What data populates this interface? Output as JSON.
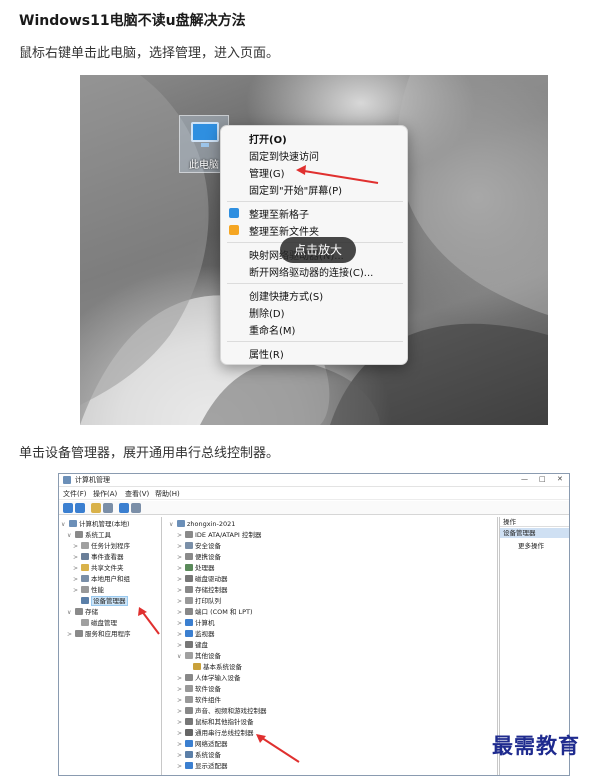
{
  "article": {
    "title": "Windows11电脑不读u盘解决方法",
    "step1": "鼠标右键单击此电脑，选择管理，进入页面。",
    "step2": "单击设备管理器，展开通用串行总线控制器。"
  },
  "screenshot1": {
    "desktop_icon_label": "此电脑",
    "context_menu": [
      {
        "label": "打开(O)",
        "bold": true
      },
      {
        "label": "固定到快速访问"
      },
      {
        "label": "管理(G)"
      },
      {
        "label": "固定到\"开始\"屏幕(P)"
      },
      {
        "label": "整理至新格子",
        "icon": "plus-square-icon"
      },
      {
        "label": "整理至新文件夹",
        "icon": "folder-icon"
      },
      {
        "label": "映射网络驱动器(N)..."
      },
      {
        "label": "断开网络驱动器的连接(C)..."
      },
      {
        "label": "创建快捷方式(S)"
      },
      {
        "label": "删除(D)"
      },
      {
        "label": "重命名(M)"
      },
      {
        "label": "属性(R)"
      }
    ],
    "tooltip": "点击放大",
    "colors": {
      "arrow": "#e0302f",
      "accent_blue": "#2f8fe0",
      "accent_orange": "#f5a623"
    }
  },
  "screenshot2": {
    "window_title": "计算机管理",
    "window_buttons": [
      "—",
      "□",
      "✕"
    ],
    "menu": [
      "文件(F)",
      "操作(A)",
      "查看(V)",
      "帮助(H)"
    ],
    "left_tree": [
      {
        "label": "计算机管理(本地)",
        "level": 0,
        "exp": "∨"
      },
      {
        "label": "系统工具",
        "level": 1,
        "exp": "∨"
      },
      {
        "label": "任务计划程序",
        "level": 2,
        "exp": ">"
      },
      {
        "label": "事件查看器",
        "level": 2,
        "exp": ">"
      },
      {
        "label": "共享文件夹",
        "level": 2,
        "exp": ">"
      },
      {
        "label": "本地用户和组",
        "level": 2,
        "exp": ">"
      },
      {
        "label": "性能",
        "level": 2,
        "exp": ">"
      },
      {
        "label": "设备管理器",
        "level": 2,
        "exp": "",
        "selected": true
      },
      {
        "label": "存储",
        "level": 1,
        "exp": "∨"
      },
      {
        "label": "磁盘管理",
        "level": 2,
        "exp": ""
      },
      {
        "label": "服务和应用程序",
        "level": 1,
        "exp": ">"
      }
    ],
    "device_tree": [
      {
        "label": "zhongxin-2021",
        "level": 0,
        "exp": "∨"
      },
      {
        "label": "IDE ATA/ATAPI 控制器",
        "level": 1,
        "exp": ">"
      },
      {
        "label": "安全设备",
        "level": 1,
        "exp": ">"
      },
      {
        "label": "便携设备",
        "level": 1,
        "exp": ">"
      },
      {
        "label": "处理器",
        "level": 1,
        "exp": ">"
      },
      {
        "label": "磁盘驱动器",
        "level": 1,
        "exp": ">"
      },
      {
        "label": "存储控制器",
        "level": 1,
        "exp": ">"
      },
      {
        "label": "打印队列",
        "level": 1,
        "exp": ">"
      },
      {
        "label": "端口 (COM 和 LPT)",
        "level": 1,
        "exp": ">"
      },
      {
        "label": "计算机",
        "level": 1,
        "exp": ">"
      },
      {
        "label": "监视器",
        "level": 1,
        "exp": ">"
      },
      {
        "label": "键盘",
        "level": 1,
        "exp": ">"
      },
      {
        "label": "其他设备",
        "level": 1,
        "exp": "∨"
      },
      {
        "label": "基本系统设备",
        "level": 2,
        "exp": ""
      },
      {
        "label": "人体学输入设备",
        "level": 1,
        "exp": ">"
      },
      {
        "label": "软件设备",
        "level": 1,
        "exp": ">"
      },
      {
        "label": "软件组件",
        "level": 1,
        "exp": ">"
      },
      {
        "label": "声音、视频和游戏控制器",
        "level": 1,
        "exp": ">"
      },
      {
        "label": "鼠标和其他指针设备",
        "level": 1,
        "exp": ">"
      },
      {
        "label": "通用串行总线控制器",
        "level": 1,
        "exp": ">"
      },
      {
        "label": "网络适配器",
        "level": 1,
        "exp": ">"
      },
      {
        "label": "系统设备",
        "level": 1,
        "exp": ">"
      },
      {
        "label": "显示适配器",
        "level": 1,
        "exp": ">"
      }
    ],
    "operations": {
      "header": "操作",
      "selected": "设备管理器",
      "more": "更多操作"
    }
  },
  "watermark": "最需教育"
}
